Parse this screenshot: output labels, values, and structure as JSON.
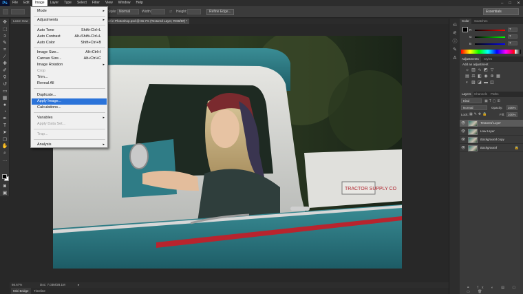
{
  "app": {
    "logo": "Ps"
  },
  "menubar": {
    "items": [
      "File",
      "Edit",
      "Image",
      "Layer",
      "Type",
      "Select",
      "Filter",
      "View",
      "Window",
      "Help"
    ],
    "window_controls": [
      "–",
      "□",
      "✕"
    ]
  },
  "options": {
    "style_label": "Style:",
    "style_value": "Normal",
    "width_label": "Width:",
    "height_label": "Height:",
    "refine_button": "Refine Edge...",
    "workspace": "Essentials"
  },
  "tabs": {
    "left_tab": "Learn How",
    "active_tab": "er in Photoshop.psd @ 66.7% (Textured Layer, RGB/8#) *"
  },
  "status": {
    "zoom": "66.67%",
    "doc": "Doc: 7.03M/28.1M"
  },
  "bottom_tabs": [
    "Mini Bridge",
    "Timeline"
  ],
  "image_menu": {
    "items": [
      {
        "label": "Mode",
        "submenu": true
      },
      {
        "label": "Adjustments",
        "submenu": true
      },
      {
        "label": "Auto Tone",
        "shortcut": "Shift+Ctrl+L"
      },
      {
        "label": "Auto Contrast",
        "shortcut": "Alt+Shift+Ctrl+L"
      },
      {
        "label": "Auto Color",
        "shortcut": "Shift+Ctrl+B"
      },
      {
        "label": "Image Size...",
        "shortcut": "Alt+Ctrl+I"
      },
      {
        "label": "Canvas Size...",
        "shortcut": "Alt+Ctrl+C"
      },
      {
        "label": "Image Rotation",
        "submenu": true
      },
      {
        "label": "Crop",
        "disabled": true
      },
      {
        "label": "Trim..."
      },
      {
        "label": "Reveal All"
      },
      {
        "label": "Duplicate..."
      },
      {
        "label": "Apply Image...",
        "highlighted": true
      },
      {
        "label": "Calculations..."
      },
      {
        "label": "Variables",
        "submenu": true
      },
      {
        "label": "Apply Data Set...",
        "disabled": true
      },
      {
        "label": "Trap...",
        "disabled": true
      },
      {
        "label": "Analysis",
        "submenu": true
      }
    ],
    "submenu_arrow": "▸"
  },
  "color_panel": {
    "tabs": [
      "Color",
      "Swatches"
    ],
    "rows": [
      {
        "label": "R",
        "value": "7"
      },
      {
        "label": "G",
        "value": "7"
      },
      {
        "label": "B",
        "value": "7"
      }
    ]
  },
  "adjustments_panel": {
    "tabs": [
      "Adjustments",
      "Styles"
    ],
    "heading": "Add an adjustment"
  },
  "layers_panel": {
    "tabs": [
      "Layers",
      "Channels",
      "Paths"
    ],
    "kind": "Kind",
    "blend_mode": "Normal",
    "opacity_label": "Opacity:",
    "opacity_value": "100%",
    "lock_label": "Lock:",
    "fill_label": "Fill:",
    "fill_value": "100%",
    "layers": [
      {
        "name": "Textured Layer",
        "selected": true
      },
      {
        "name": "Low Layer"
      },
      {
        "name": "Background copy"
      },
      {
        "name": "Background",
        "locked": true
      }
    ]
  },
  "photo_badge": "TRACTOR SUPPLY CO"
}
